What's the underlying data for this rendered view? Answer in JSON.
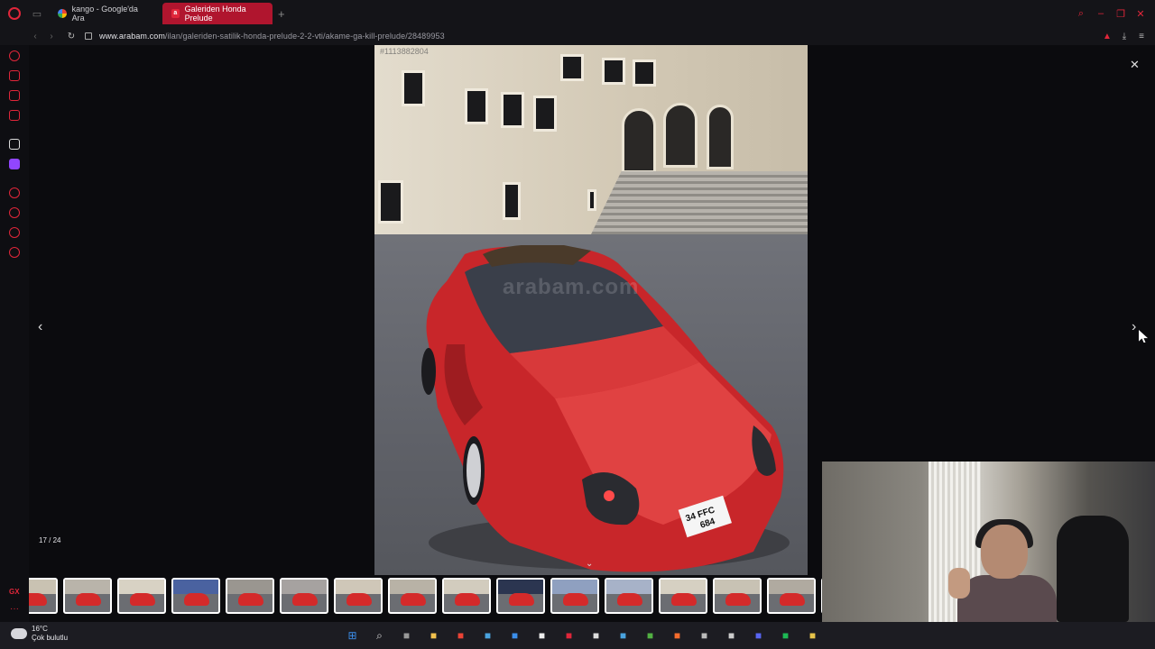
{
  "browser": {
    "tabs": [
      {
        "label": "kango - Google'da Ara",
        "active": false
      },
      {
        "label": "Galeriden Honda Prelude",
        "active": true
      }
    ],
    "url_domain": "www.arabam.com",
    "url_path": "/ilan/galeriden-satilik-honda-prelude-2-2-vti/akame-ga-kill-prelude/28489953"
  },
  "viewer": {
    "photo_id": "#1113882804",
    "watermark": "arabam.com",
    "counter": "17 / 24",
    "plate_line1": "34 FFC",
    "plate_line2": "684",
    "thumbnail_count": 16
  },
  "taskbar": {
    "temperature": "16°C",
    "weather": "Çok bulutlu",
    "icons": [
      "windows-start-icon",
      "search-icon",
      "task-view-icon",
      "file-explorer-icon",
      "chrome-icon",
      "photos-icon",
      "store-icon",
      "steam-client-icon",
      "opera-gx-icon",
      "epic-games-icon",
      "steam-icon",
      "xbox-icon",
      "origin-icon",
      "obs-icon",
      "notepad-icon",
      "discord-icon",
      "spotify-icon",
      "files-icon"
    ]
  },
  "colors": {
    "accent": "#e0263a",
    "active_tab": "#b0152e",
    "car_red": "#d42a2a"
  }
}
